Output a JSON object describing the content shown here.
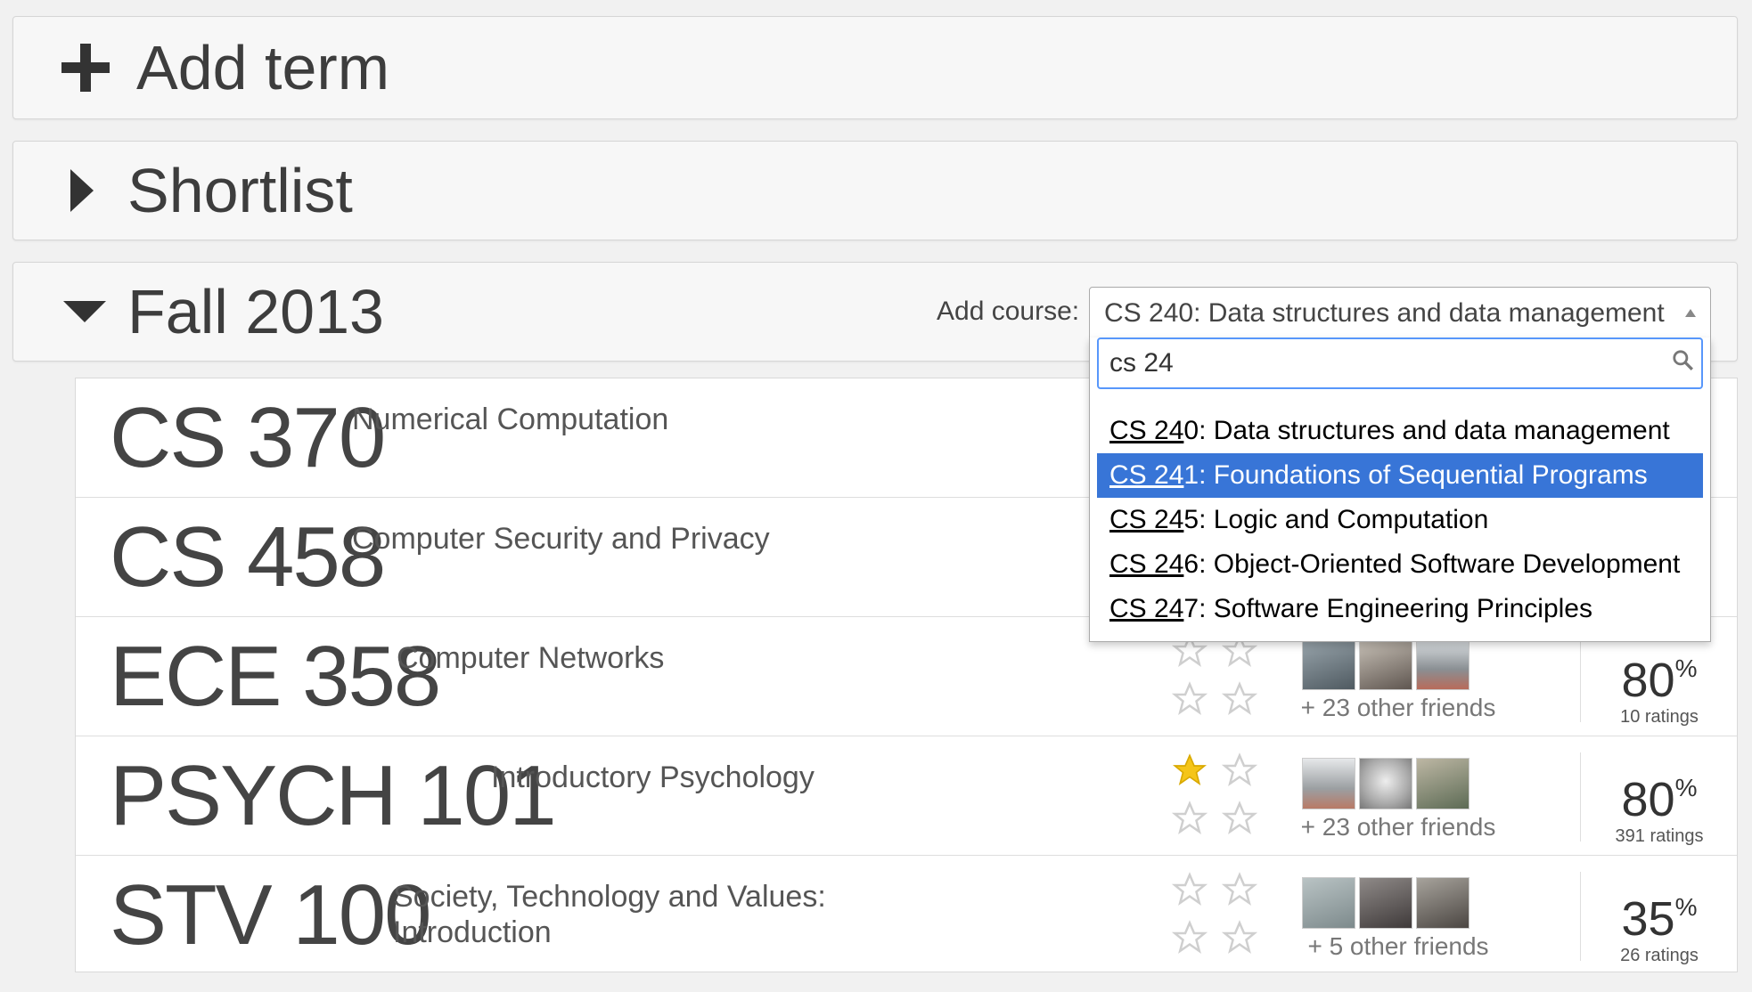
{
  "panels": {
    "add_term": "Add term",
    "shortlist": "Shortlist",
    "term": "Fall 2013"
  },
  "add_course": {
    "label": "Add course:",
    "selected": "CS 240: Data structures and data management",
    "search_value": "cs 24",
    "results": [
      {
        "match": "CS 24",
        "rest": "0: Data structures and data management",
        "highlighted": false
      },
      {
        "match": "CS 24",
        "rest": "1: Foundations of Sequential Programs",
        "highlighted": true
      },
      {
        "match": "CS 24",
        "rest": "5: Logic and Computation",
        "highlighted": false
      },
      {
        "match": "CS 24",
        "rest": "6: Object-Oriented Software Development",
        "highlighted": false
      },
      {
        "match": "CS 24",
        "rest": "7: Software Engineering Principles",
        "highlighted": false
      }
    ]
  },
  "courses": [
    {
      "code": "CS 370",
      "name": "Numerical Computation"
    },
    {
      "code": "CS 458",
      "name": "Computer Security and Privacy"
    },
    {
      "code": "ECE 358",
      "name": "Computer Networks",
      "stars_filled": 0,
      "friends_text": "+ 23 other friends",
      "rating_pct": "80",
      "rating_unit": "%",
      "rating_count": "10 ratings"
    },
    {
      "code": "PSYCH 101",
      "name": "Introductory Psychology",
      "stars_filled": 1,
      "friends_text": "+ 23 other friends",
      "rating_pct": "80",
      "rating_unit": "%",
      "rating_count": "391 ratings"
    },
    {
      "code": "STV 100",
      "name": "Society, Technology and Values: Introduction",
      "stars_filled": 0,
      "friends_text": "+ 5 other friends",
      "rating_pct": "35",
      "rating_unit": "%",
      "rating_count": "26 ratings"
    }
  ],
  "colors": {
    "highlight": "#3875d7",
    "focus_border": "#5897fb",
    "star_filled": "#f5c518",
    "star_empty": "#cfcfcf"
  }
}
